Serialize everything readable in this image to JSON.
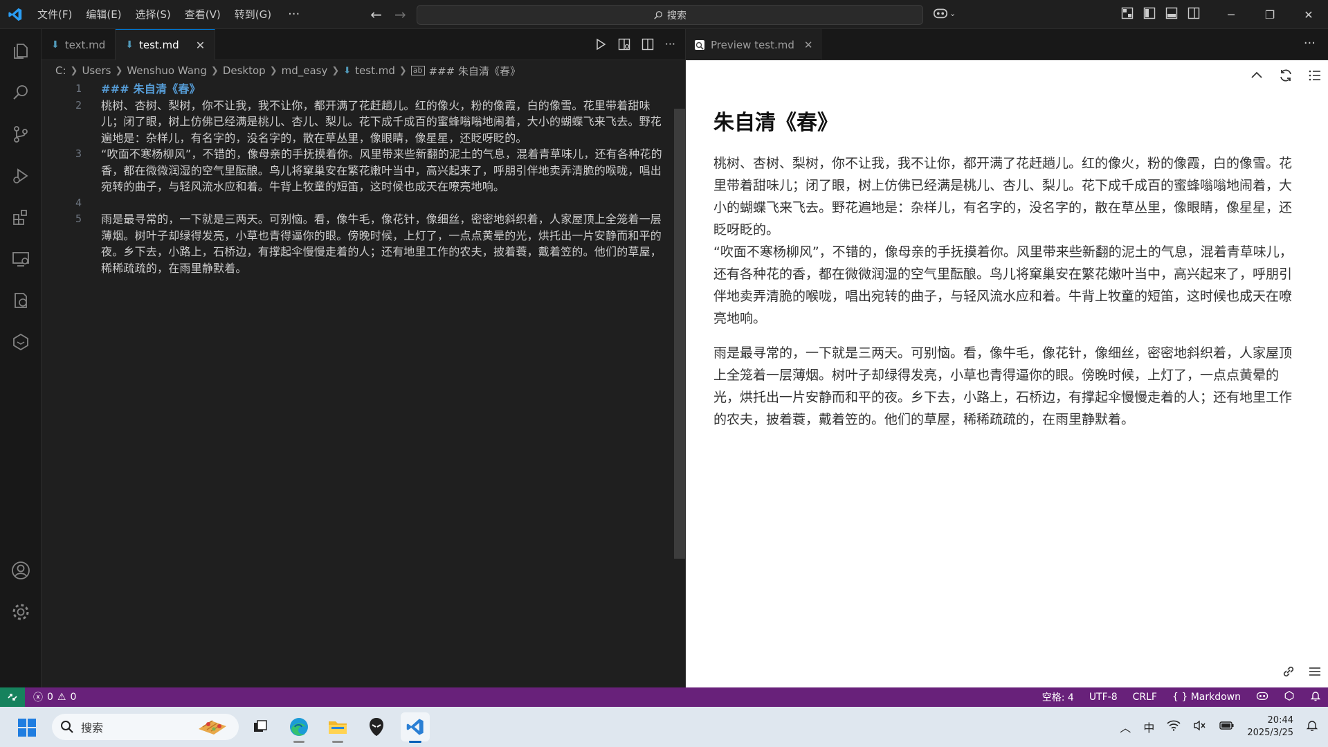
{
  "titlebar": {
    "menu": [
      "文件(F)",
      "编辑(E)",
      "选择(S)",
      "查看(V)",
      "转到(G)"
    ],
    "more": "···",
    "search_placeholder": "搜索"
  },
  "editor": {
    "tabs": [
      {
        "label": "text.md",
        "active": false
      },
      {
        "label": "test.md",
        "active": true
      }
    ],
    "breadcrumb": [
      "C:",
      "Users",
      "Wenshuo Wang",
      "Desktop",
      "md_easy",
      "test.md",
      "### 朱自清《春》"
    ],
    "lines": [
      {
        "num": "1",
        "text": "### 朱自清《春》",
        "heading": true
      },
      {
        "num": "2",
        "text": "桃树、杏树、梨树，你不让我，我不让你，都开满了花赶趟儿。红的像火，粉的像霞，白的像雪。花里带着甜味儿；闭了眼，树上仿佛已经满是桃儿、杏儿、梨儿。花下成千成百的蜜蜂嗡嗡地闹着，大小的蝴蝶飞来飞去。野花遍地是：杂样儿，有名字的，没名字的，散在草丛里，像眼睛，像星星，还眨呀眨的。",
        "heading": false
      },
      {
        "num": "3",
        "text": "“吹面不寒杨柳风”，不错的，像母亲的手抚摸着你。风里带来些新翻的泥土的气息，混着青草味儿，还有各种花的香，都在微微润湿的空气里酝酿。鸟儿将窠巢安在繁花嫩叶当中，高兴起来了，呼朋引伴地卖弄清脆的喉咙，唱出宛转的曲子，与轻风流水应和着。牛背上牧童的短笛，这时候也成天在嘹亮地响。",
        "heading": false
      },
      {
        "num": "4",
        "text": "",
        "heading": false
      },
      {
        "num": "5",
        "text": "雨是最寻常的，一下就是三两天。可别恼。看，像牛毛，像花针，像细丝，密密地斜织着，人家屋顶上全笼着一层薄烟。树叶子却绿得发亮，小草也青得逼你的眼。傍晚时候，上灯了，一点点黄晕的光，烘托出一片安静而和平的夜。乡下去，小路上，石桥边，有撑起伞慢慢走着的人；还有地里工作的农夫，披着蓑，戴着笠的。他们的草屋，稀稀疏疏的，在雨里静默着。",
        "heading": false
      }
    ]
  },
  "preview": {
    "tab_label": "Preview test.md",
    "heading": "朱自清《春》",
    "paragraphs": [
      "桃树、杏树、梨树，你不让我，我不让你，都开满了花赶趟儿。红的像火，粉的像霞，白的像雪。花里带着甜味儿；闭了眼，树上仿佛已经满是桃儿、杏儿、梨儿。花下成千成百的蜜蜂嗡嗡地闹着，大小的蝴蝶飞来飞去。野花遍地是：杂样儿，有名字的，没名字的，散在草丛里，像眼睛，像星星，还眨呀眨的。\n“吹面不寒杨柳风”，不错的，像母亲的手抚摸着你。风里带来些新翻的泥土的气息，混着青草味儿，还有各种花的香，都在微微润湿的空气里酝酿。鸟儿将窠巢安在繁花嫩叶当中，高兴起来了，呼朋引伴地卖弄清脆的喉咙，唱出宛转的曲子，与轻风流水应和着。牛背上牧童的短笛，这时候也成天在嘹亮地响。",
      "雨是最寻常的，一下就是三两天。可别恼。看，像牛毛，像花针，像细丝，密密地斜织着，人家屋顶上全笼着一层薄烟。树叶子却绿得发亮，小草也青得逼你的眼。傍晚时候，上灯了，一点点黄晕的光，烘托出一片安静而和平的夜。乡下去，小路上，石桥边，有撑起伞慢慢走着的人；还有地里工作的农夫，披着蓑，戴着笠的。他们的草屋，稀稀疏疏的，在雨里静默着。"
    ]
  },
  "statusbar": {
    "errors": "0",
    "warnings": "0",
    "indent": "空格: 4",
    "encoding": "UTF-8",
    "eol": "CRLF",
    "language": "Markdown"
  },
  "taskbar": {
    "search_placeholder": "搜索",
    "ime": "中",
    "time": "20:44",
    "date": "2025/3/25"
  },
  "colors": {
    "statusbar": "#68217a",
    "remote": "#16825d",
    "accent": "#0078d4",
    "heading_code": "#569cd6"
  }
}
